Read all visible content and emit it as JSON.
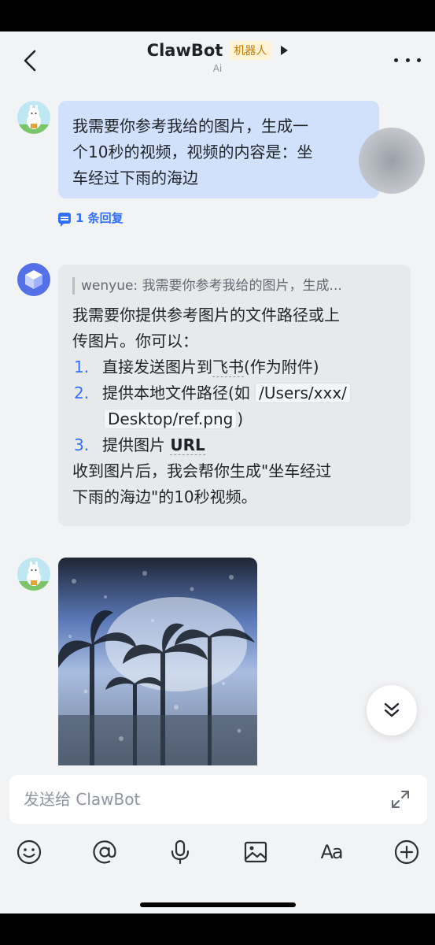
{
  "header": {
    "title": "ClawBot",
    "bot_tag": "机器人",
    "subtitle": "Ai"
  },
  "messages": {
    "user_message": {
      "lines": [
        "我需要你参考我给的图片，生成一",
        "个10秒的视频，视频的内容是：坐",
        "车经过下雨的海边"
      ],
      "reply_count_label": "1 条回复"
    },
    "bot_reply": {
      "quote": "wenyue: 我需要你参考我给的图片，生成...",
      "intro_1": "我需要你提供参考图片的文件路径或上",
      "intro_2": "传图片。你可以：",
      "item1_num": "1.",
      "item1_pre": "直接发送图片到",
      "item1_link": "飞书",
      "item1_post": "(作为附件)",
      "item2_num": "2.",
      "item2_pre": "提供本地文件路径(如 ",
      "item2_code_a": "/Users/xxx/",
      "item2_code_b": "Desktop/ref.png",
      "item2_post": ")",
      "item3_num": "3.",
      "item3_pre": "提供图片 ",
      "item3_bold": "URL",
      "outro_1": "收到图片后，我会帮你生成\"坐车经过",
      "outro_2": "下雨的海边\"的10秒视频。"
    },
    "image_message": {
      "alt": "rainy palm trees"
    }
  },
  "composer": {
    "placeholder": "发送给 ClawBot"
  },
  "toolbar_icons": [
    "emoji-icon",
    "mention-icon",
    "microphone-icon",
    "image-icon",
    "text-format-icon",
    "add-icon"
  ],
  "toolbar": {
    "format_label": "Aa"
  },
  "colors": {
    "accent": "#3370ff",
    "user_bubble": "#d1e1fc",
    "bot_bubble": "#e8e9eb",
    "background": "#f2f3f5"
  }
}
